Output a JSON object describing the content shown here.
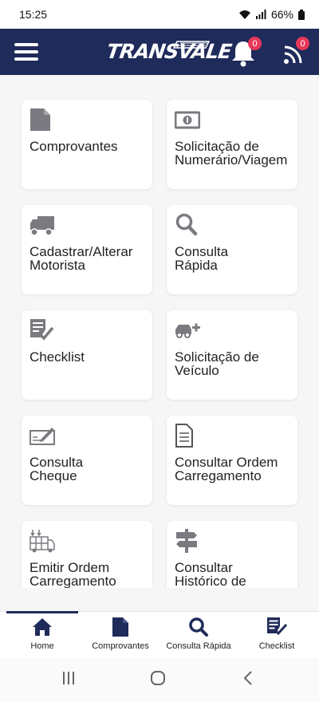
{
  "status_bar": {
    "time": "15:25",
    "battery": "66%"
  },
  "header": {
    "logo_text": "TRANSVALE",
    "notifications_count": "0",
    "feed_count": "0"
  },
  "cards": [
    {
      "label": "Comprovantes",
      "icon": "document-icon"
    },
    {
      "label": "Solicitação de\nNumerário/Viagem",
      "icon": "money-icon"
    },
    {
      "label": "Cadastrar/Alterar\nMotorista",
      "icon": "truck-icon"
    },
    {
      "label": "Consulta\nRápida",
      "icon": "search-icon"
    },
    {
      "label": "Checklist",
      "icon": "checklist-icon"
    },
    {
      "label": "Solicitação de\nVeículo",
      "icon": "add-vehicle-icon"
    },
    {
      "label": "Consulta\nCheque",
      "icon": "cheque-icon"
    },
    {
      "label": "Consultar Ordem\nCarregamento",
      "icon": "file-lines-icon"
    },
    {
      "label": "Emitir Ordem\nCarregamento",
      "icon": "cargo-icon"
    },
    {
      "label": "Consultar\nHistórico de\nViagem",
      "icon": "signpost-icon"
    }
  ],
  "bottom_nav": [
    {
      "label": "Home",
      "icon": "home-icon"
    },
    {
      "label": "Comprovantes",
      "icon": "document-icon"
    },
    {
      "label": "Consulta Rápida",
      "icon": "search-icon"
    },
    {
      "label": "Checklist",
      "icon": "checklist-icon"
    }
  ],
  "colors": {
    "header": "#1f2b5a",
    "badge": "#e8385a",
    "icon_gray": "#7a7a80",
    "nav_icon": "#1f2b5a"
  }
}
